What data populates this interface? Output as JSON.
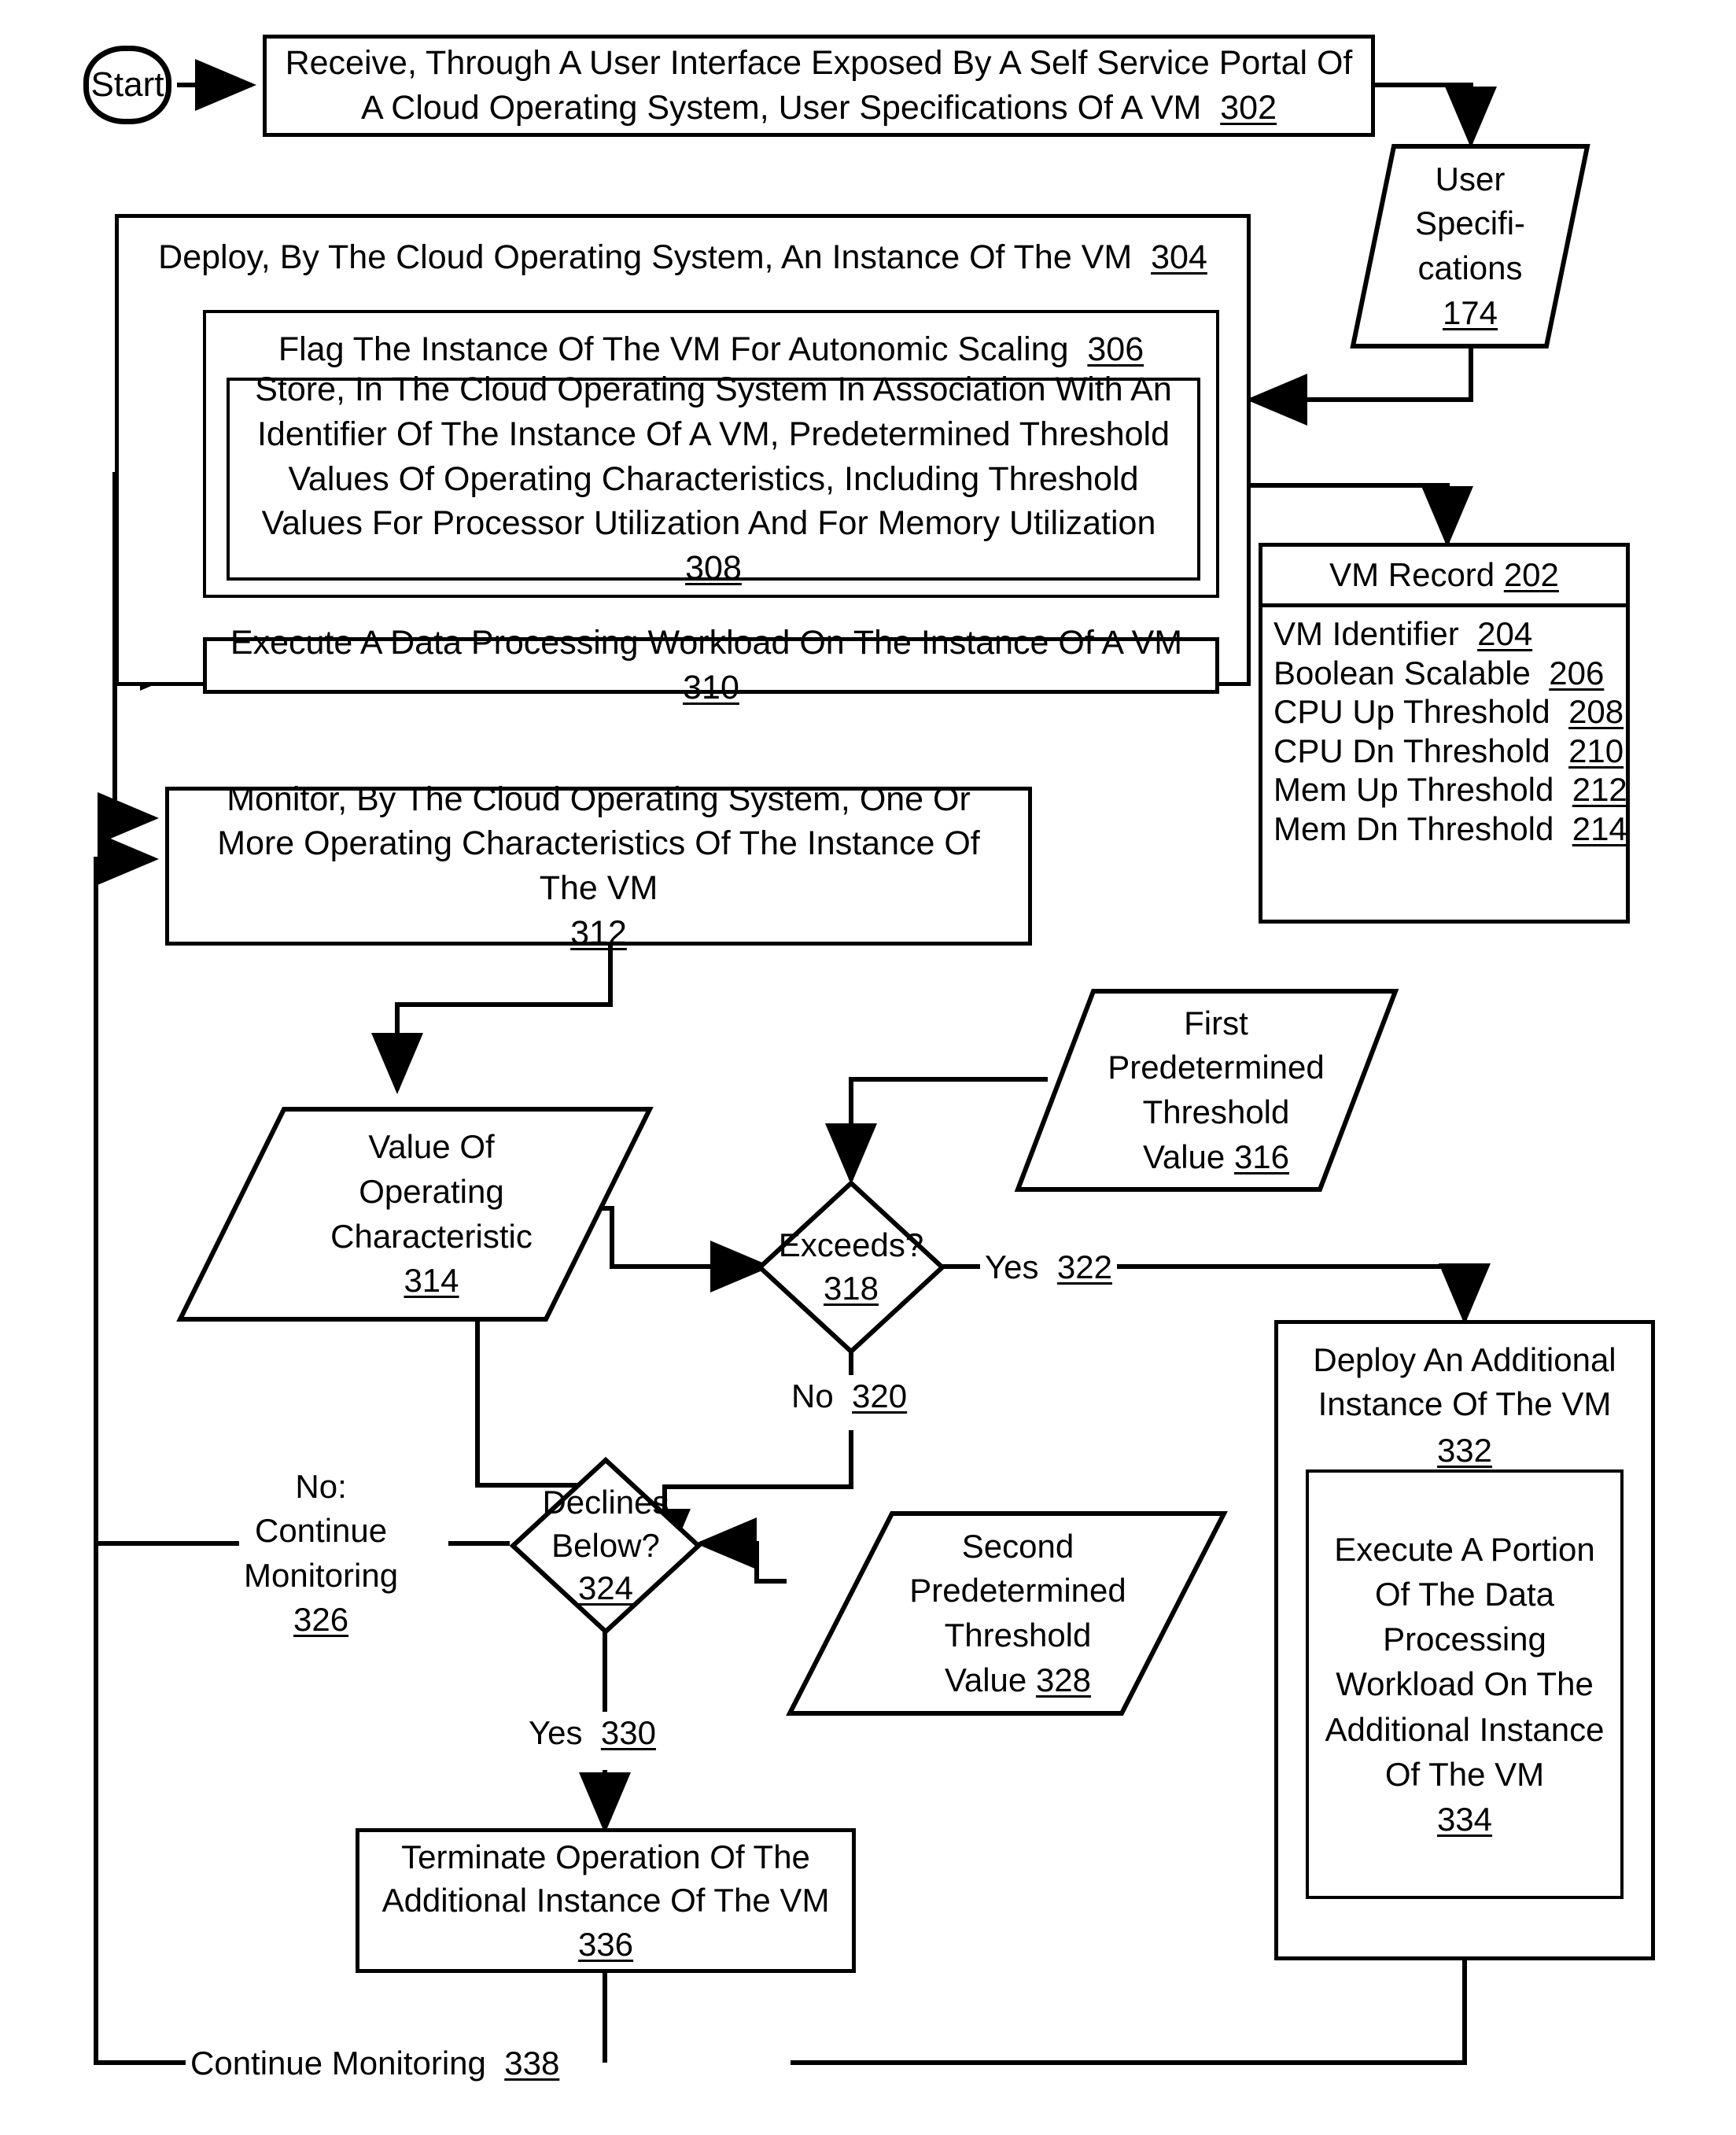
{
  "figure": {
    "type": "patent-flowchart",
    "title": "Autonomic VM scaling flowchart"
  },
  "nodes": {
    "start": {
      "label": "Start"
    },
    "n302": {
      "text": "Receive, Through A User Interface Exposed By A Self Service Portal Of A Cloud Operating System, User Specifications Of A VM",
      "ref": "302"
    },
    "n174": {
      "text": "User\nSpecifi-\ncations",
      "ref": "174"
    },
    "n304": {
      "text": "Deploy, By The Cloud Operating System, An Instance Of The VM",
      "ref": "304"
    },
    "n306": {
      "text": "Flag The Instance Of The VM For Autonomic Scaling",
      "ref": "306"
    },
    "n308": {
      "text": "Store, In The Cloud Operating System In Association With An Identifier Of The Instance Of A VM, Predetermined Threshold Values Of Operating Characteristics, Including Threshold Values For Processor Utilization And For Memory Utilization",
      "ref": "308"
    },
    "n310": {
      "text": "Execute A Data Processing Workload On The Instance Of A VM",
      "ref": "310"
    },
    "n312": {
      "text": "Monitor, By The Cloud Operating System, One Or More Operating Characteristics Of The Instance Of The VM",
      "ref": "312"
    },
    "n314": {
      "text": "Value Of\nOperating\nCharacteristic",
      "ref": "314"
    },
    "n316": {
      "text": "First\nPredetermined\nThreshold\nValue",
      "ref": "316"
    },
    "n318": {
      "text": "Exceeds?",
      "ref": "318"
    },
    "n324": {
      "text": "Declines\nBelow?",
      "ref": "324"
    },
    "n328": {
      "text": "Second\nPredetermined\nThreshold\nValue",
      "ref": "328"
    },
    "n332": {
      "text": "Deploy An Additional Instance Of The VM",
      "ref": "332"
    },
    "n334": {
      "text": "Execute A Portion Of The Data Processing Workload On The Additional Instance Of The VM",
      "ref": "334"
    },
    "n336": {
      "text": "Terminate Operation Of The Additional Instance Of The VM",
      "ref": "336"
    },
    "vm_record": {
      "title": "VM Record",
      "ref": "202",
      "fields": [
        {
          "label": "VM Identifier",
          "ref": "204"
        },
        {
          "label": "Boolean Scalable",
          "ref": "206"
        },
        {
          "label": "CPU Up Threshold",
          "ref": "208"
        },
        {
          "label": "CPU Dn Threshold",
          "ref": "210"
        },
        {
          "label": "Mem Up Threshold",
          "ref": "212"
        },
        {
          "label": "Mem Dn Threshold",
          "ref": "214"
        }
      ]
    }
  },
  "edge_labels": {
    "yes322": {
      "text": "Yes",
      "ref": "322"
    },
    "no320": {
      "text": "No",
      "ref": "320"
    },
    "no326": {
      "text": "No:\nContinue\nMonitoring",
      "ref": "326"
    },
    "yes330": {
      "text": "Yes",
      "ref": "330"
    },
    "cont338": {
      "text": "Continue Monitoring",
      "ref": "338"
    }
  },
  "colors": {
    "stroke": "#000000",
    "background": "#ffffff"
  }
}
